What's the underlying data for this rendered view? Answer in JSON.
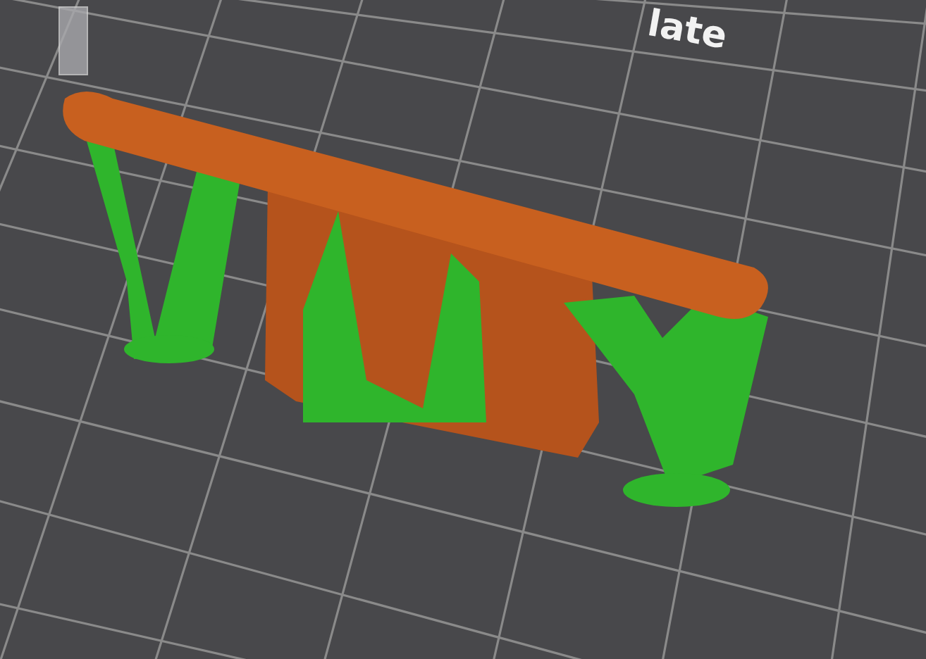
{
  "viewport": {
    "bed_label": "late"
  }
}
